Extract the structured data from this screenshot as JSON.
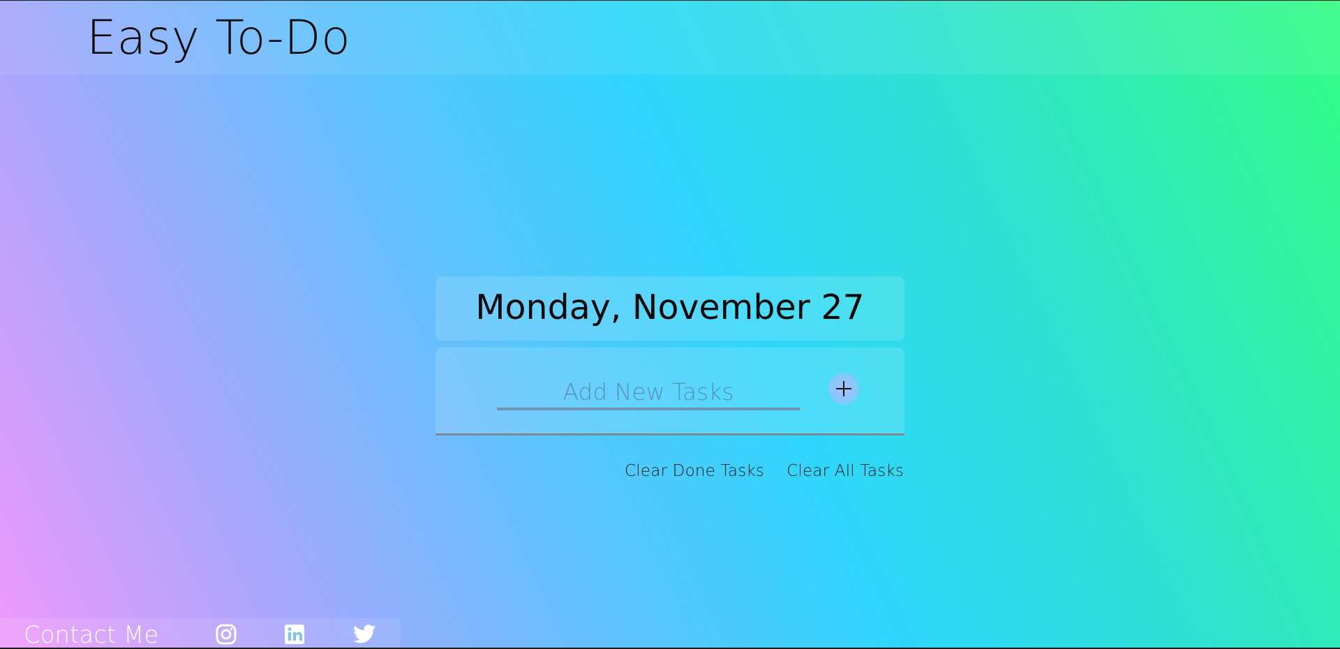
{
  "app": {
    "title": "Easy To-Do"
  },
  "date_display": {
    "text": "Monday, November 27"
  },
  "task_entry": {
    "placeholder": "Add New Tasks",
    "value": "",
    "add_icon": "plus-icon"
  },
  "actions": {
    "clear_done_label": "Clear Done Tasks",
    "clear_all_label": "Clear All Tasks"
  },
  "footer": {
    "contact_label": "Contact Me",
    "social_icons": [
      "instagram-icon",
      "linkedin-icon",
      "twitter-icon"
    ]
  },
  "colors": {
    "gradient": [
      "#f099fb",
      "#a8a6fd",
      "#2fd6fc",
      "#33fd84"
    ],
    "text_dark": "#0a0a0a",
    "footer_text": "#ffffff",
    "input_underline": "#6d95b0"
  }
}
